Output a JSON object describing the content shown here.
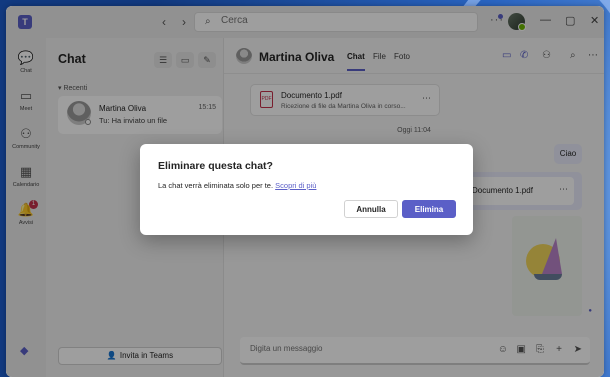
{
  "titlebar": {
    "search_placeholder": "Cerca",
    "more": "···"
  },
  "rail": {
    "items": [
      {
        "label": "Chat",
        "icon": "chat-icon"
      },
      {
        "label": "Meet",
        "icon": "video-icon"
      },
      {
        "label": "Community",
        "icon": "community-icon"
      },
      {
        "label": "Calendario",
        "icon": "calendar-icon"
      },
      {
        "label": "Avvisi",
        "icon": "bell-icon",
        "badge": "1"
      }
    ]
  },
  "chatlist": {
    "title": "Chat",
    "section": "Recenti",
    "item": {
      "name": "Martina Oliva",
      "time": "15:15",
      "preview": "Tu: Ha inviato un file"
    },
    "invite_label": "Invita in Teams"
  },
  "main": {
    "contact_name": "Martina Oliva",
    "tabs": [
      "Chat",
      "File",
      "Foto"
    ],
    "file_card": {
      "name": "Documento 1.pdf",
      "description": "Ricezione di file da Martina Oliva in corso..."
    },
    "date_separator": "Oggi 11:04",
    "message_ciao": "Ciao",
    "my_file": "Documento 1.pdf",
    "composer_placeholder": "Digita un messaggio"
  },
  "dialog": {
    "title": "Eliminare questa chat?",
    "body": "La chat verrà eliminata solo per te.",
    "link": "Scopri di più",
    "cancel_label": "Annulla",
    "delete_label": "Elimina"
  },
  "colors": {
    "accent": "#5b5fc7",
    "overlay": "rgba(0,0,0,0.38)",
    "badge": "#c4314b"
  }
}
